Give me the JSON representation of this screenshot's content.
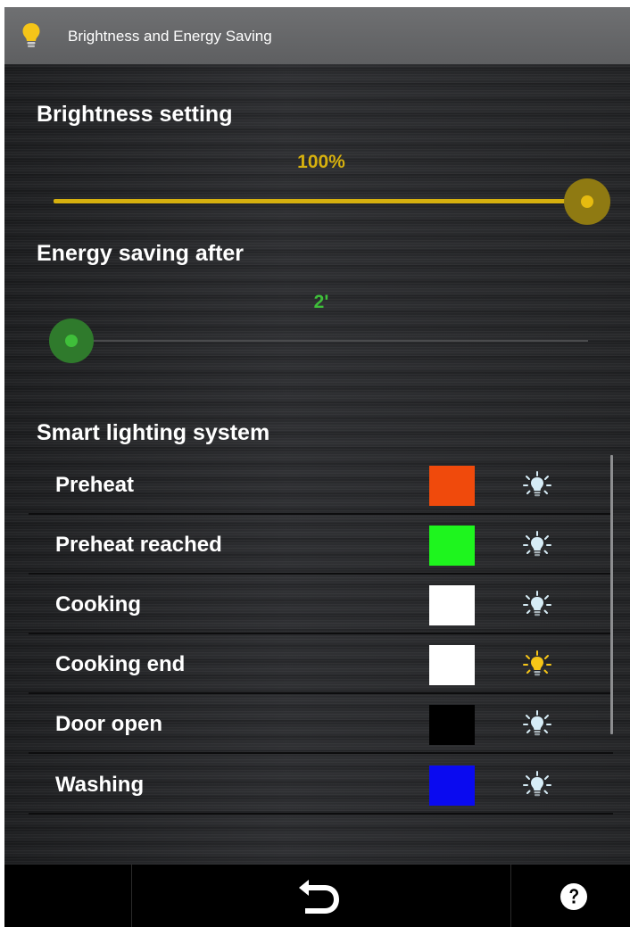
{
  "header": {
    "title": "Brightness and Energy Saving",
    "icon": "lightbulb-icon",
    "icon_color": "#f5c518"
  },
  "brightness": {
    "heading": "Brightness setting",
    "value_label": "100%",
    "value_percent": 100,
    "accent_color": "#d6b00e"
  },
  "energy_saving": {
    "heading": "Energy saving after",
    "value_label": "2'",
    "value_fraction": 0,
    "accent_color": "#3fbf3a"
  },
  "smart_lighting": {
    "heading": "Smart lighting system",
    "items": [
      {
        "label": "Preheat",
        "color": "#f04a0c",
        "bulb": "bulb-icon",
        "bulb_active": false
      },
      {
        "label": "Preheat reached",
        "color": "#1ef51e",
        "bulb": "bulb-icon",
        "bulb_active": false
      },
      {
        "label": "Cooking",
        "color": "#ffffff",
        "bulb": "bulb-icon",
        "bulb_active": false
      },
      {
        "label": "Cooking end",
        "color": "#ffffff",
        "bulb": "bulb-icon",
        "bulb_active": true
      },
      {
        "label": "Door open",
        "color": "#000000",
        "bulb": "bulb-icon",
        "bulb_active": false
      },
      {
        "label": "Washing",
        "color": "#0a0af0",
        "bulb": "bulb-icon",
        "bulb_active": false
      }
    ]
  },
  "bottom_nav": {
    "back_icon": "back-arrow-icon",
    "help_icon": "help-icon"
  }
}
